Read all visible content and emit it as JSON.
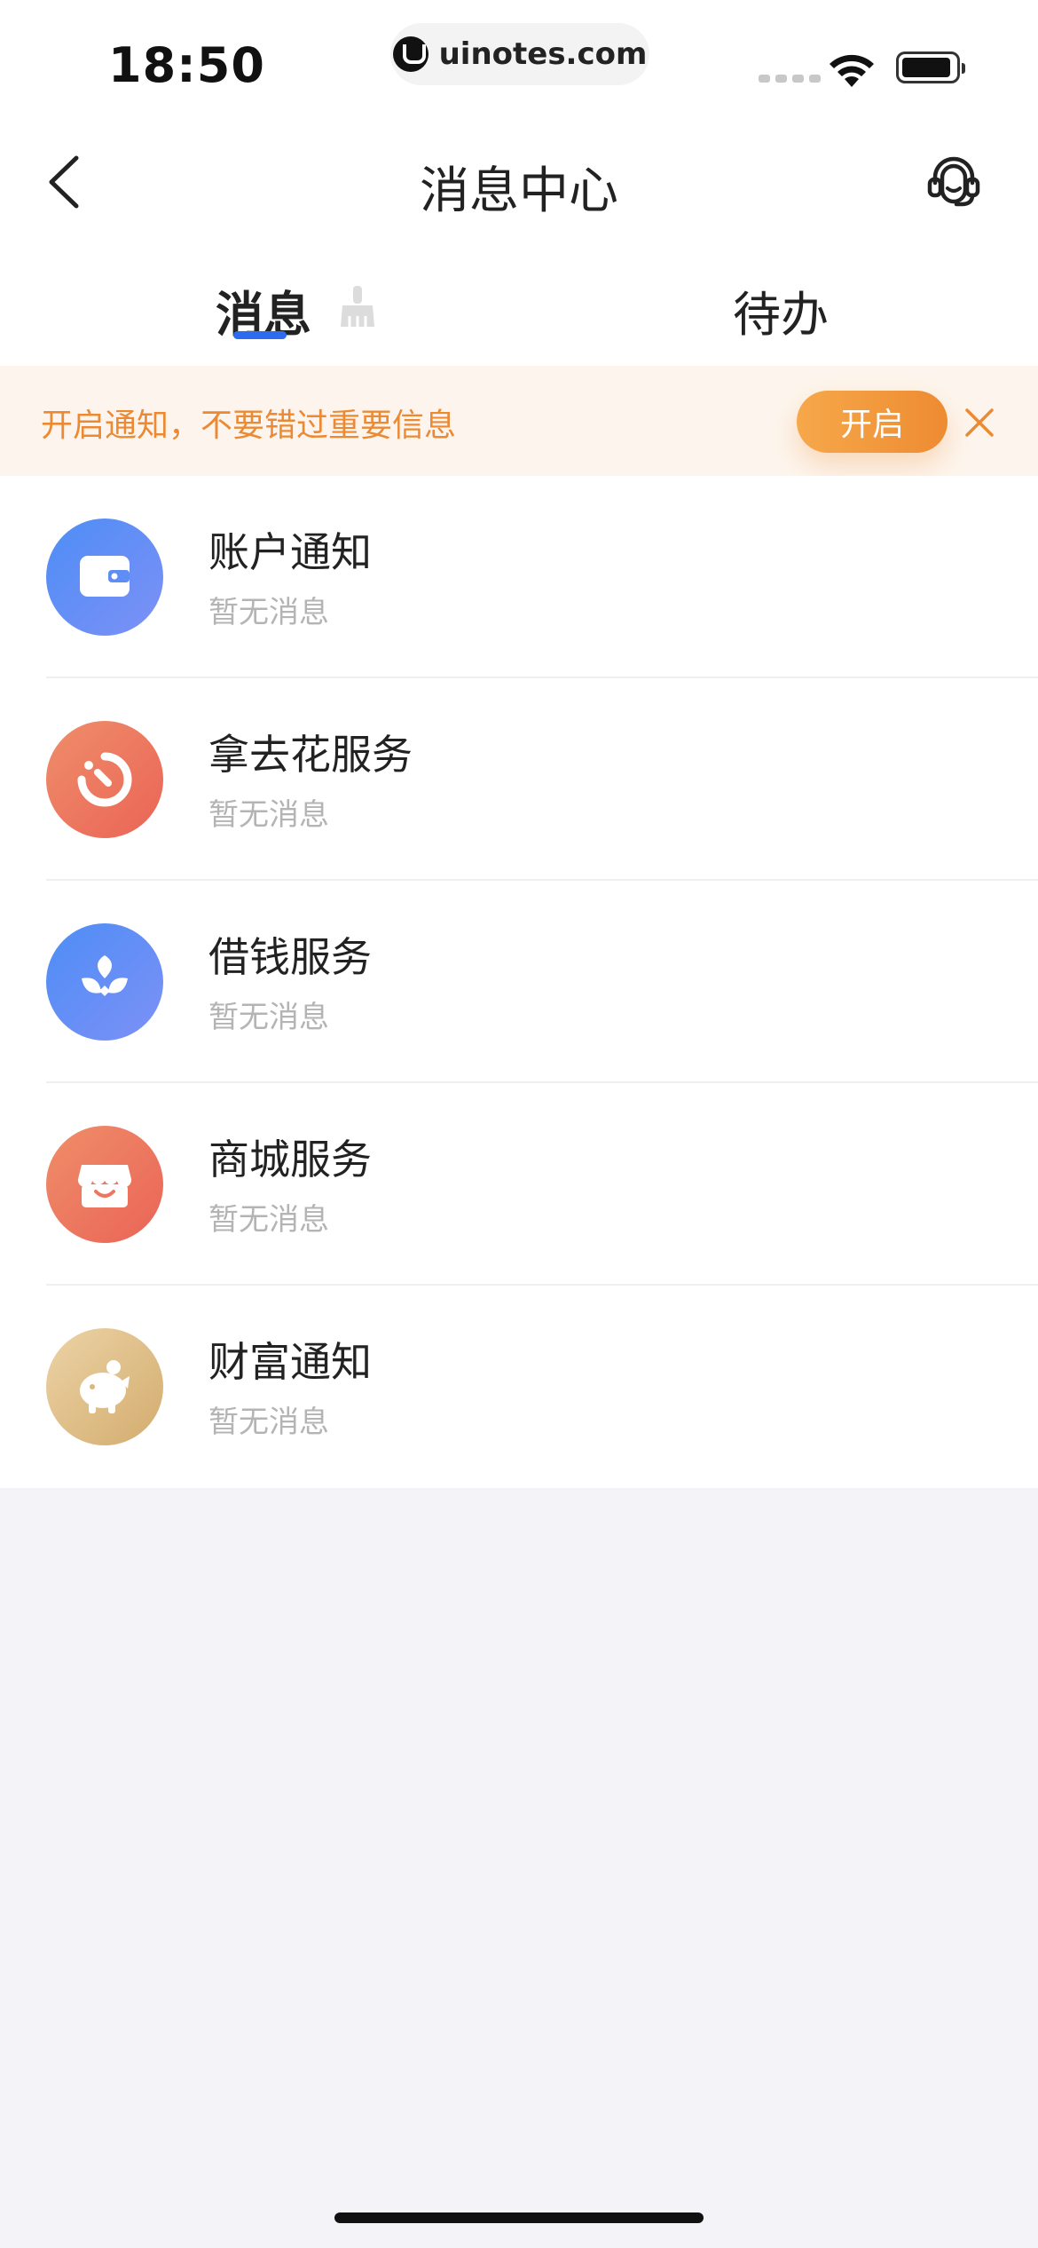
{
  "status_bar": {
    "time": "18:50",
    "watermark": "uinotes.com"
  },
  "nav": {
    "title": "消息中心",
    "back_icon": "back-chevron-icon",
    "service_icon": "customer-service-headset-icon"
  },
  "tabs": [
    {
      "label": "消息",
      "active": true
    },
    {
      "label": "待办",
      "active": false
    }
  ],
  "banner": {
    "text": "开启通知，不要错过重要信息",
    "open_label": "开启",
    "close_icon": "close-icon"
  },
  "messages": [
    {
      "title": "账户通知",
      "subtitle": "暂无消息",
      "icon": "wallet-icon",
      "color": "#5b8ef5"
    },
    {
      "title": "拿去花服务",
      "subtitle": "暂无消息",
      "icon": "installment-icon",
      "color": "#ec7660"
    },
    {
      "title": "借钱服务",
      "subtitle": "暂无消息",
      "icon": "loan-sprout-icon",
      "color": "#5b8ef5"
    },
    {
      "title": "商城服务",
      "subtitle": "暂无消息",
      "icon": "store-icon",
      "color": "#ec7660"
    },
    {
      "title": "财富通知",
      "subtitle": "暂无消息",
      "icon": "piggy-bank-icon",
      "color": "#dfbe86"
    }
  ],
  "colors": {
    "accent_blue": "#2d6bf0",
    "banner_orange": "#ec8a34",
    "page_bg": "#f4f4f8"
  }
}
